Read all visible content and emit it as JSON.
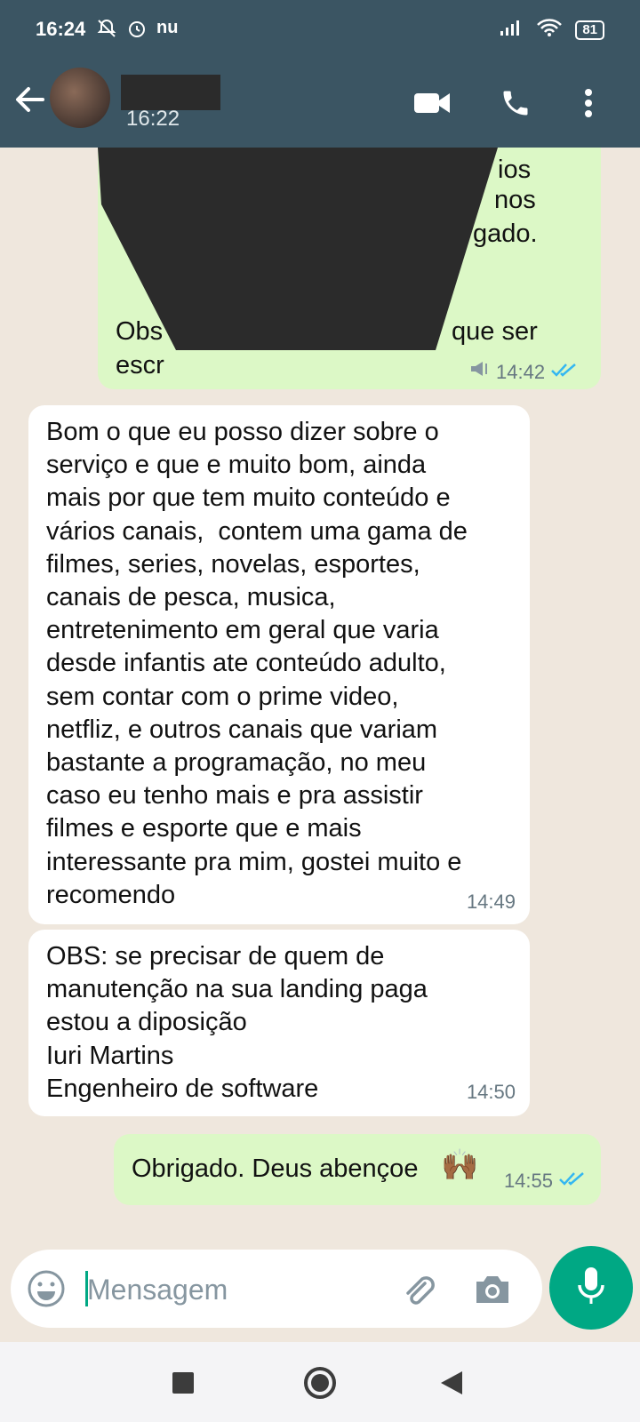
{
  "status_bar": {
    "time": "16:24",
    "carrier_icon_text": "nu",
    "battery": "81"
  },
  "header": {
    "last_seen": "16:22"
  },
  "messages": [
    {
      "direction": "out",
      "visible_fragments": [
        "ios",
        "nos",
        "gado.",
        "Obs",
        "que ser",
        "escr"
      ],
      "time": "14:42",
      "status": "read",
      "icons": [
        "broadcast-icon",
        "double-check-icon"
      ]
    },
    {
      "direction": "in",
      "text": "Bom o que eu posso dizer sobre o\nserviço e que e muito bom, ainda\nmais por que tem muito conteúdo e\nvários canais,  contem uma gama de\nfilmes, series, novelas, esportes,\ncanais de pesca, musica,\nentretenimento em geral que varia\ndesde infantis ate conteúdo adulto,\nsem contar com o prime video,\nnetfliz, e outros canais que variam\nbastante a programação, no meu\ncaso eu tenho mais e pra assistir\nfilmes e esporte que e mais\ninteressante pra mim, gostei muito e\nrecomendo",
      "time": "14:49"
    },
    {
      "direction": "in",
      "text": "OBS: se precisar de quem de\nmanutenção na sua landing paga\nestou a diposição\nIuri Martins\nEngenheiro de software",
      "time": "14:50"
    },
    {
      "direction": "out",
      "text": "Obrigado. Deus abençoe",
      "emoji": "🙌🏾",
      "time": "14:55",
      "status": "read"
    }
  ],
  "composer": {
    "placeholder": "Mensagem"
  },
  "colors": {
    "header": "#3b5563",
    "outgoing_bubble": "#dcf8c6",
    "incoming_bubble": "#ffffff",
    "accent": "#00a884",
    "read_ticks": "#34b7f1",
    "chat_background": "#efe7dd"
  },
  "icons": [
    "back-arrow-icon",
    "video-call-icon",
    "phone-icon",
    "more-vert-icon",
    "emoji-icon",
    "attach-icon",
    "camera-icon",
    "mic-icon",
    "nav-recents-icon",
    "nav-home-icon",
    "nav-back-icon"
  ]
}
